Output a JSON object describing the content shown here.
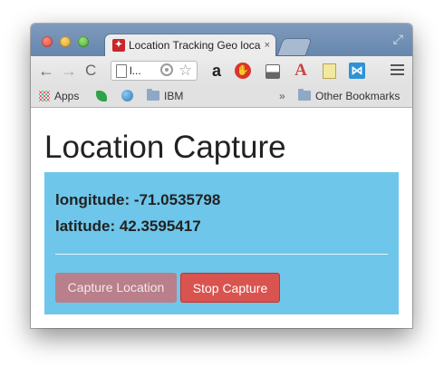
{
  "browser": {
    "tab_title": "Location Tracking Geo loca",
    "tab_close": "×",
    "url_text": "l...",
    "toolbar": {
      "back": "←",
      "forward": "→",
      "reload": "C"
    },
    "bookmarks": {
      "apps_label": "Apps",
      "ibm_label": "IBM",
      "overflow": "»",
      "other_label": "Other Bookmarks"
    }
  },
  "page": {
    "heading": "Location Capture",
    "longitude_text": "longitude: -71.0535798",
    "latitude_text": "latitude: 42.3595417",
    "buttons": {
      "capture_label": "Capture Location",
      "stop_label": "Stop Capture"
    }
  },
  "colors": {
    "panel": "#6ec6ea",
    "capture_button": "#b97f8b",
    "stop_button": "#d9534f"
  }
}
